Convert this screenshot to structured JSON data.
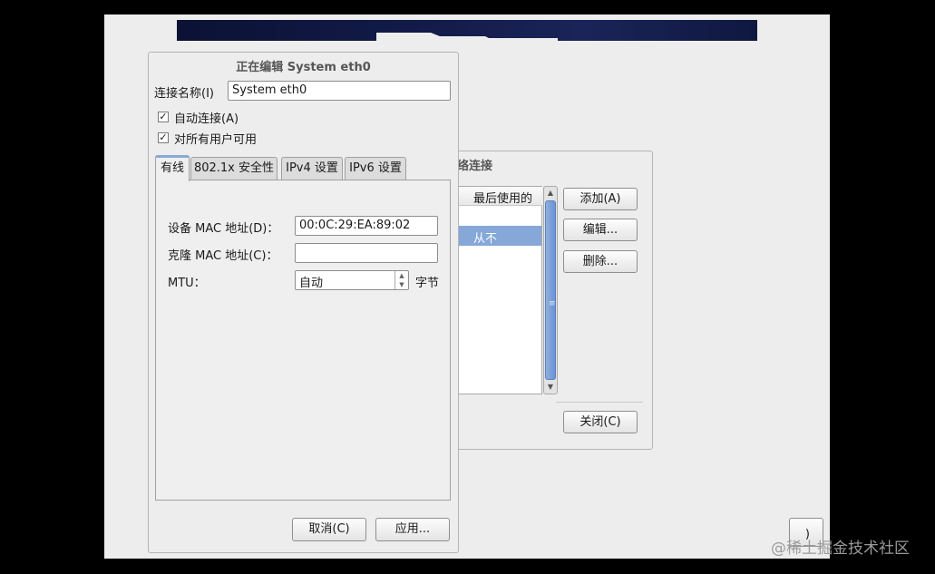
{
  "edit_dialog": {
    "title": "正在编辑 System eth0",
    "connection_name_label": "连接名称(I)",
    "connection_name_value": "System eth0",
    "auto_connect_label": "自动连接(A)",
    "all_users_label": "对所有用户可用",
    "tabs": [
      "有线",
      "802.1x 安全性",
      "IPv4 设置",
      "IPv6 设置"
    ],
    "device_mac_label": "设备 MAC 地址(D)：",
    "device_mac_value": "00:0C:29:EA:89:02",
    "clone_mac_label": "克隆 MAC 地址(C)：",
    "clone_mac_value": "",
    "mtu_label": "MTU：",
    "mtu_value": "自动",
    "mtu_unit": "字节",
    "cancel_label": "取消(C)",
    "apply_label": "应用..."
  },
  "network_dialog": {
    "title_visible": "络连接",
    "column_header": "最后使用的",
    "row_last_used": "从不",
    "add_label": "添加(A)",
    "edit_label": "编辑...",
    "delete_label": "删除...",
    "close_label": "关闭(C)"
  },
  "background": {
    "partial_button_label": ")"
  },
  "watermark": "@稀土掘金技术社区"
}
